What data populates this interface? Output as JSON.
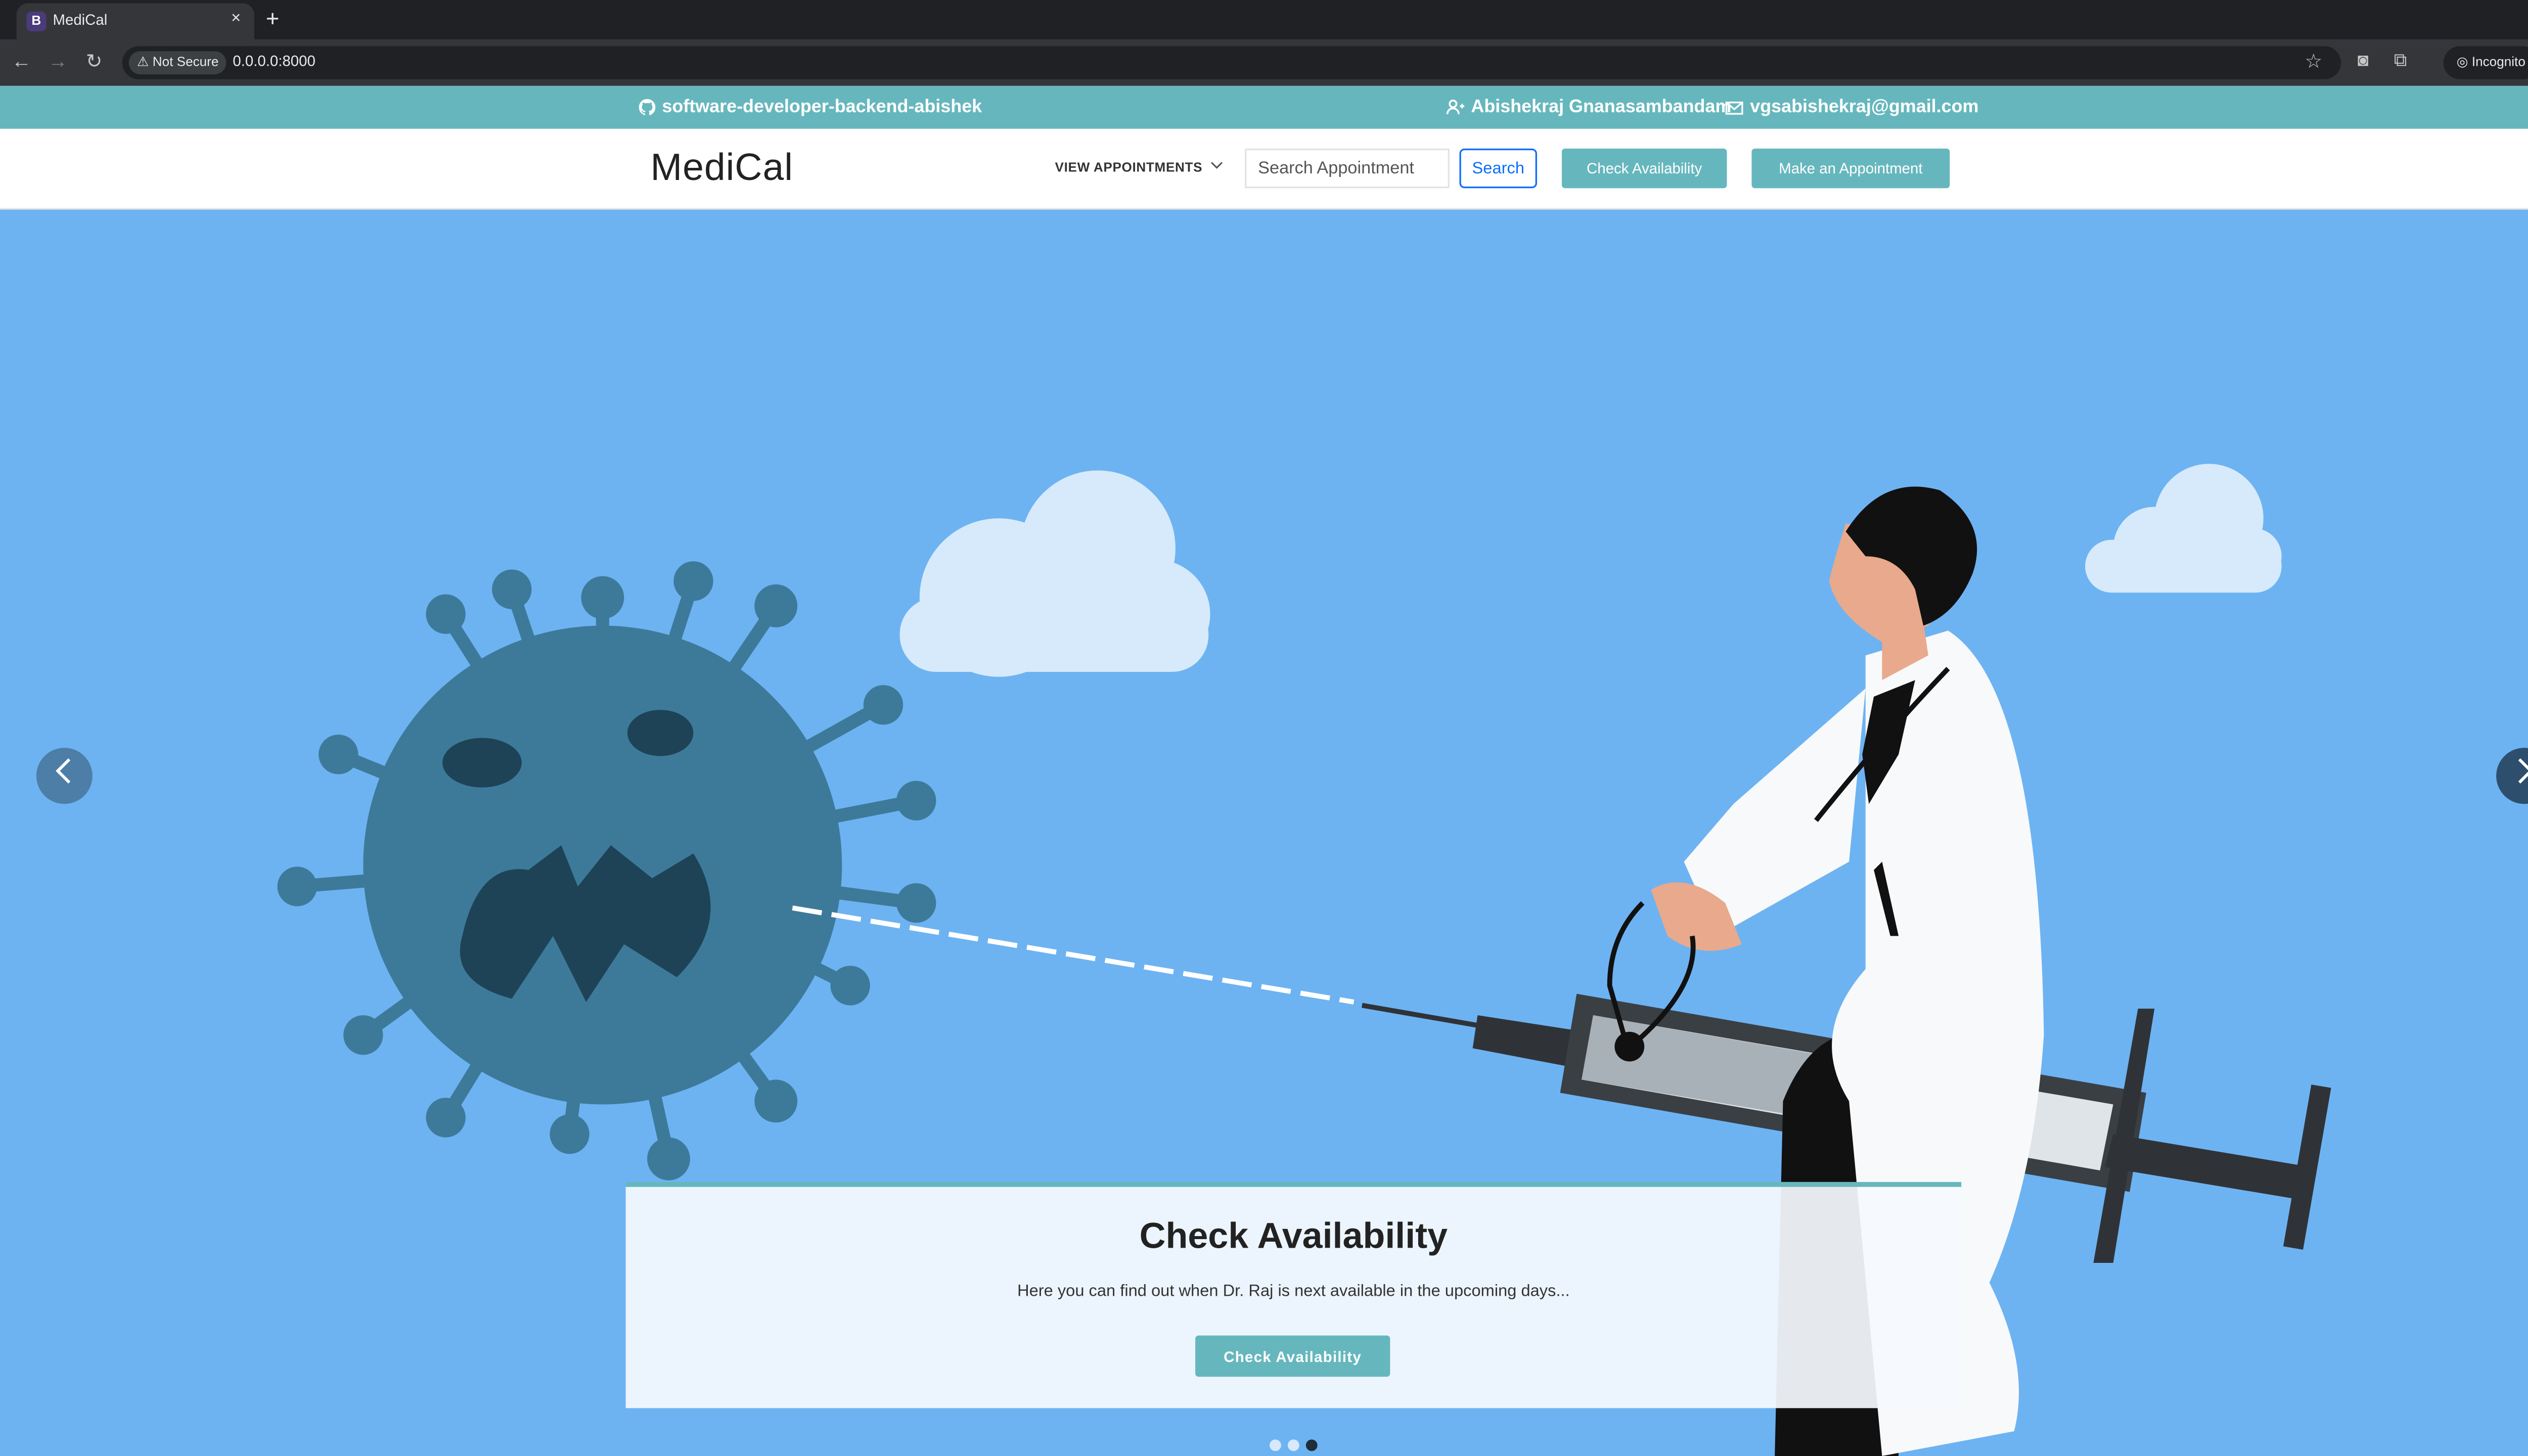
{
  "browser": {
    "tab_title": "MediCal",
    "tab_favicon": "B",
    "security_label": "Not Secure",
    "url": "0.0.0.0:8000",
    "profile_label": "Incognito",
    "new_tab": "+",
    "tab_close": "×"
  },
  "topbar": {
    "github": "software-developer-backend-abishek",
    "name": "Abishekraj Gnanasambandam",
    "email": "vgsabishekraj@gmail.com"
  },
  "header": {
    "logo": "MediCal",
    "view_appointments": "VIEW APPOINTMENTS",
    "search_placeholder": "Search Appointment",
    "search_button": "Search",
    "check_availability": "Check Availability",
    "make_appointment": "Make an Appointment"
  },
  "hero": {
    "caption_title": "Check Availability",
    "caption_text": "Here you can find out when Dr. Raj is next available in the upcoming days...",
    "caption_button": "Check Availability",
    "slides_total": 3,
    "active_slide": 3
  },
  "colors": {
    "accent": "#66b7bd",
    "sky": "#6db3f2",
    "virus": "#3d7a9a",
    "virus_dark": "#1e4356",
    "link_blue": "#0d6efd"
  },
  "icons": [
    "github-icon",
    "user-icon",
    "mail-icon",
    "chevron-down-icon",
    "carousel-prev-icon",
    "carousel-next-icon",
    "star-icon",
    "back-icon",
    "forward-icon",
    "reload-icon"
  ]
}
